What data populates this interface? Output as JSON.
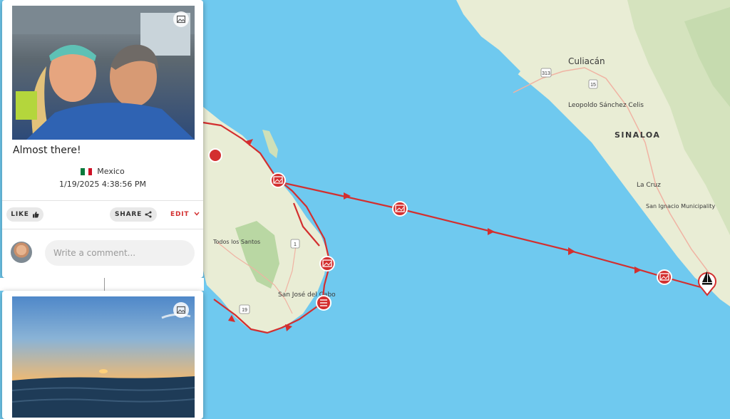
{
  "map": {
    "places": [
      {
        "name": "Culiacán"
      },
      {
        "name": "Leopoldo Sánchez Celis"
      },
      {
        "name": "SINALOA"
      },
      {
        "name": "La Cruz"
      },
      {
        "name": "San Ignacio Municipality"
      },
      {
        "name": "Todos los Santos"
      },
      {
        "name": "San José del Cabo"
      }
    ],
    "highway_shields": [
      "313",
      "15",
      "15",
      "1",
      "19"
    ],
    "route_color": "#d32f2f",
    "water_color": "#6fc9ef",
    "land_color": "#e9edd5"
  },
  "post": {
    "title": "Almost there!",
    "country": "Mexico",
    "date": "1/19/2025 4:38:56 PM",
    "like_label": "LIKE",
    "share_label": "SHARE",
    "edit_label": "EDIT",
    "comment_placeholder": "Write a comment..."
  },
  "icons": {
    "photo": "image-icon",
    "like": "thumbs-up-icon",
    "share": "share-icon",
    "edit": "chevron-down-icon",
    "boat": "sailboat-icon",
    "log": "list-icon"
  }
}
